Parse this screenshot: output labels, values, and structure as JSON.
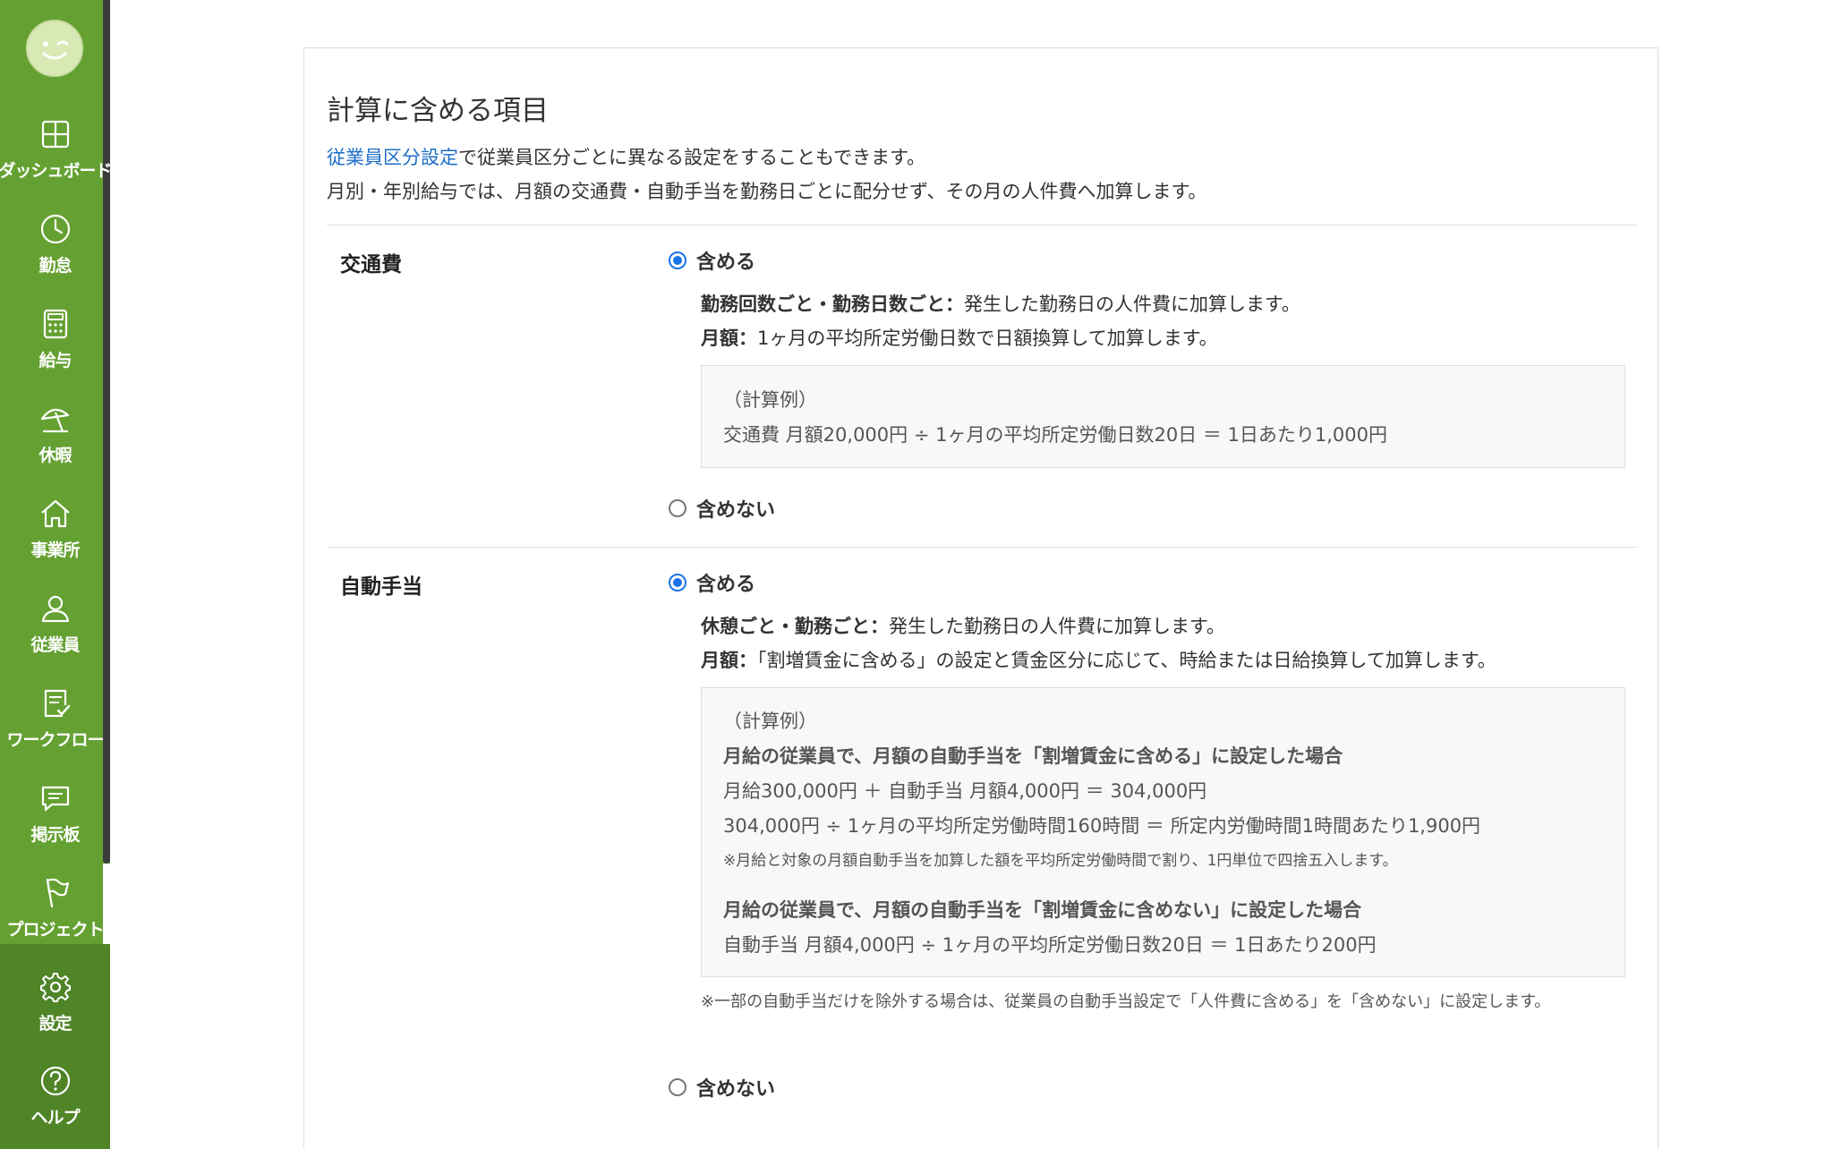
{
  "sidebar": {
    "items": [
      {
        "label": "ダッシュボード",
        "icon": "dashboard-icon"
      },
      {
        "label": "勤怠",
        "icon": "clock-icon"
      },
      {
        "label": "給与",
        "icon": "calculator-icon"
      },
      {
        "label": "休暇",
        "icon": "beach-umbrella-icon"
      },
      {
        "label": "事業所",
        "icon": "home-icon"
      },
      {
        "label": "従業員",
        "icon": "person-icon"
      },
      {
        "label": "ワークフロー",
        "icon": "checklist-icon"
      },
      {
        "label": "掲示板",
        "icon": "chat-icon"
      },
      {
        "label": "プロジェクト",
        "icon": "flag-icon"
      },
      {
        "label": "設定",
        "icon": "gear-icon"
      },
      {
        "label": "ヘルプ",
        "icon": "help-icon"
      }
    ],
    "active": "設定",
    "colors": {
      "background": "#65a132",
      "active": "#4f8427"
    }
  },
  "panel": {
    "title": "計算に含める項目",
    "desc_link": "従業員区分設定",
    "desc_line1_rest": "で従業員区分ごとに異なる設定をすることもできます。",
    "desc_line2": "月別・年別給与では、月額の交通費・自動手当を勤務日ごとに配分せず、その月の人件費へ加算します。"
  },
  "transport": {
    "title": "交通費",
    "include_label": "含める",
    "exclude_label": "含めない",
    "selected": "含める",
    "line1_bold": "勤務回数ごと・勤務日数ごと：",
    "line1_rest": "発生した勤務日の人件費に加算します。",
    "line2_bold": "月額：",
    "line2_rest": "1ヶ月の平均所定労働日数で日額換算して加算します。",
    "example_heading": "（計算例）",
    "example_line": "交通費 月額20,000円 ÷ 1ヶ月の平均所定労働日数20日 ＝ 1日あたり1,000円"
  },
  "allowance": {
    "title": "自動手当",
    "include_label": "含める",
    "exclude_label": "含めない",
    "selected": "含める",
    "line1_bold": "休憩ごと・勤務ごと：",
    "line1_rest": "発生した勤務日の人件費に加算します。",
    "line2_bold": "月額：",
    "line2_rest": "「割増賃金に含める」の設定と賃金区分に応じて、時給または日給換算して加算します。",
    "example_heading": "（計算例）",
    "case1_heading": "月給の従業員で、月額の自動手当を「割増賃金に含める」に設定した場合",
    "case1_line1": "月給300,000円 ＋ 自動手当 月額4,000円 ＝ 304,000円",
    "case1_line2": "304,000円 ÷ 1ヶ月の平均所定労働時間160時間 ＝ 所定内労働時間1時間あたり1,900円",
    "case1_note": "※月給と対象の月額自動手当を加算した額を平均所定労働時間で割り、1円単位で四捨五入します。",
    "case2_heading": "月給の従業員で、月額の自動手当を「割増賃金に含めない」に設定した場合",
    "case2_line1": "自動手当 月額4,000円 ÷ 1ヶ月の平均所定労働日数20日 ＝ 1日あたり200円",
    "footnote": "※一部の自動手当だけを除外する場合は、従業員の自動手当設定で「人件費に含める」を「含めない」に設定します。"
  }
}
